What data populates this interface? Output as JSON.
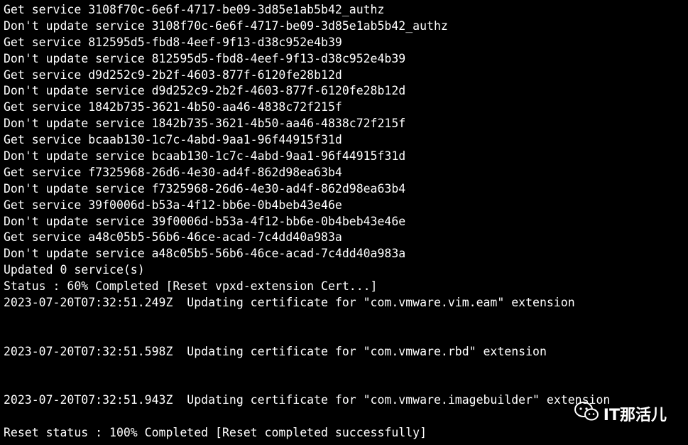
{
  "terminal": {
    "lines": [
      "Get service 3108f70c-6e6f-4717-be09-3d85e1ab5b42_authz",
      "Don't update service 3108f70c-6e6f-4717-be09-3d85e1ab5b42_authz",
      "Get service 812595d5-fbd8-4eef-9f13-d38c952e4b39",
      "Don't update service 812595d5-fbd8-4eef-9f13-d38c952e4b39",
      "Get service d9d252c9-2b2f-4603-877f-6120fe28b12d",
      "Don't update service d9d252c9-2b2f-4603-877f-6120fe28b12d",
      "Get service 1842b735-3621-4b50-aa46-4838c72f215f",
      "Don't update service 1842b735-3621-4b50-aa46-4838c72f215f",
      "Get service bcaab130-1c7c-4abd-9aa1-96f44915f31d",
      "Don't update service bcaab130-1c7c-4abd-9aa1-96f44915f31d",
      "Get service f7325968-26d6-4e30-ad4f-862d98ea63b4",
      "Don't update service f7325968-26d6-4e30-ad4f-862d98ea63b4",
      "Get service 39f0006d-b53a-4f12-bb6e-0b4beb43e46e",
      "Don't update service 39f0006d-b53a-4f12-bb6e-0b4beb43e46e",
      "Get service a48c05b5-56b6-46ce-acad-7c4dd40a983a",
      "Don't update service a48c05b5-56b6-46ce-acad-7c4dd40a983a",
      "Updated 0 service(s)",
      "Status : 60% Completed [Reset vpxd-extension Cert...]",
      "2023-07-20T07:32:51.249Z  Updating certificate for \"com.vmware.vim.eam\" extension",
      "",
      "",
      "2023-07-20T07:32:51.598Z  Updating certificate for \"com.vmware.rbd\" extension",
      "",
      "",
      "2023-07-20T07:32:51.943Z  Updating certificate for \"com.vmware.imagebuilder\" extension",
      "",
      "Reset status : 100% Completed [Reset completed successfully]"
    ]
  },
  "watermark": {
    "text": "IT那活儿",
    "icon": "wechat-icon",
    "color": "#ffffff"
  },
  "colors": {
    "background": "#000000",
    "foreground": "#ffffff"
  }
}
